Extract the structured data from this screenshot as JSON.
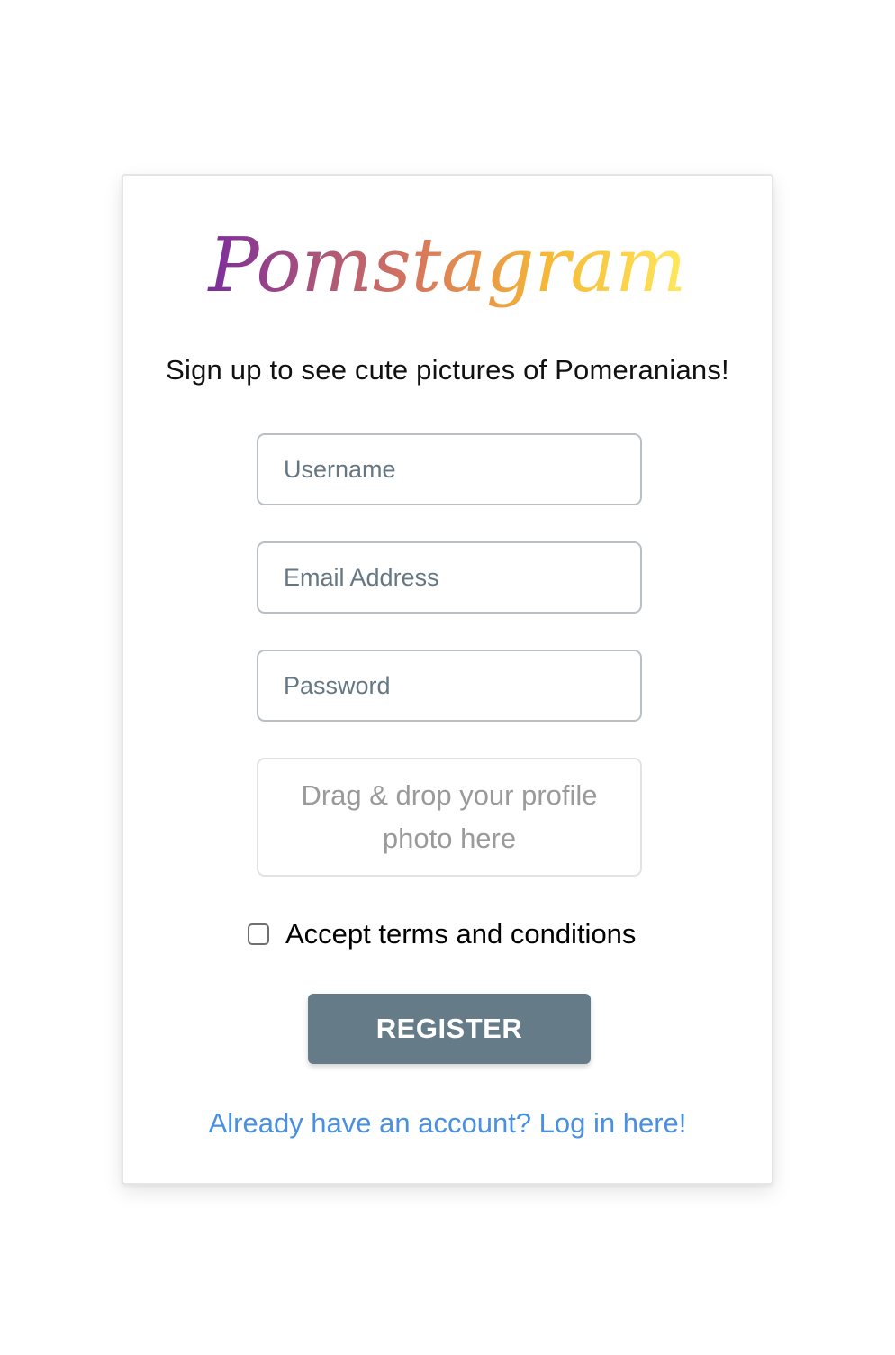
{
  "brand": {
    "logo_text": "Pomstagram",
    "gradient_colors": [
      "#7b2d9c",
      "#e3803e",
      "#f5b635",
      "#ffe95c"
    ]
  },
  "tagline": "Sign up to see cute pictures of Pomeranians!",
  "form": {
    "username_placeholder": "Username",
    "email_placeholder": "Email Address",
    "password_placeholder": "Password",
    "dropzone_text": "Drag & drop your profile photo here",
    "terms_label": "Accept terms and conditions",
    "terms_checked": false,
    "register_label": "REGISTER"
  },
  "login_link": "Already have an account? Log in here!",
  "colors": {
    "button": "#667b88",
    "link": "#4a90e2",
    "input_border": "#b8c0c6"
  }
}
